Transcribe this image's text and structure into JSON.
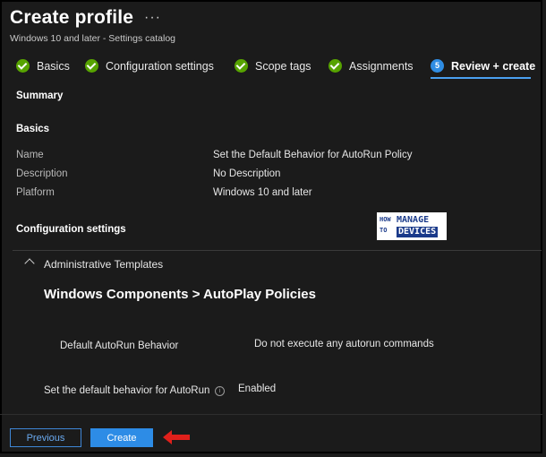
{
  "header": {
    "title": "Create profile",
    "more": "···",
    "subtitle": "Windows 10 and later - Settings catalog"
  },
  "steps": [
    {
      "label": "Basics",
      "state": "done"
    },
    {
      "label": "Configuration settings",
      "state": "done"
    },
    {
      "label": "Scope tags",
      "state": "done"
    },
    {
      "label": "Assignments",
      "state": "done"
    },
    {
      "label": "Review + create",
      "state": "active",
      "number": "5"
    }
  ],
  "summary": {
    "heading": "Summary",
    "basics_heading": "Basics",
    "rows": [
      {
        "label": "Name",
        "value": "Set the Default Behavior for AutoRun Policy"
      },
      {
        "label": "Description",
        "value": "No Description"
      },
      {
        "label": "Platform",
        "value": "Windows 10 and later"
      }
    ],
    "config_heading": "Configuration settings"
  },
  "logo": {
    "how": "HOW",
    "to": "TO",
    "manage": "MANAGE",
    "devices": "DEVICES"
  },
  "config": {
    "category": "Administrative Templates",
    "group": "Windows Components > AutoPlay Policies",
    "settings": [
      {
        "name": "Default AutoRun Behavior",
        "value": "Do not execute any autorun commands"
      },
      {
        "name": "Set the default behavior for AutoRun",
        "value": "Enabled",
        "info": "i"
      }
    ]
  },
  "footer": {
    "previous": "Previous",
    "create": "Create"
  },
  "colors": {
    "accent": "#2d8ce6",
    "success": "#57a300",
    "arrow": "#e0201b"
  }
}
